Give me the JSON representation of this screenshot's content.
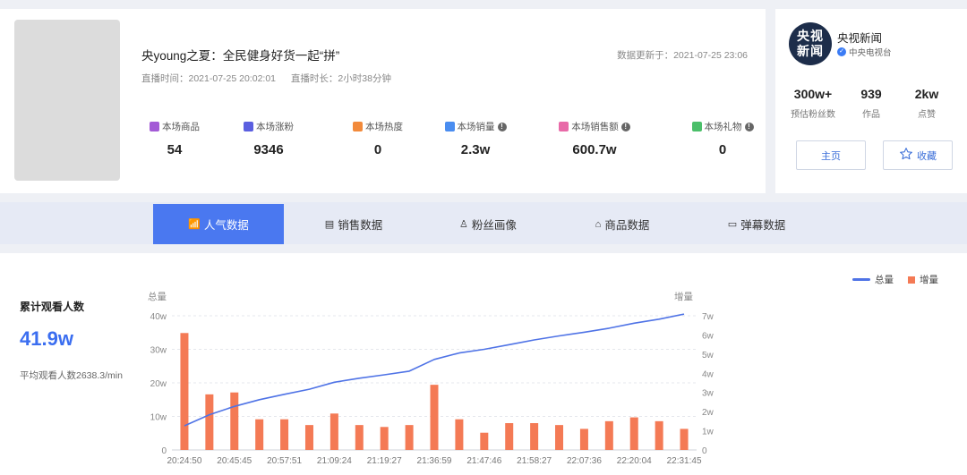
{
  "live": {
    "title": "央young之夏：全民健身好货一起“拼”",
    "start_time": "直播时间：2021-07-25 20:02:01",
    "duration": "直播时长：2小时38分钟",
    "updated": "数据更新于：2021-07-25 23:06",
    "stats": [
      {
        "label": "本场商品",
        "value": "54",
        "icon": "bag-icon",
        "color": "#a35ad6",
        "info": false
      },
      {
        "label": "本场涨粉",
        "value": "9346",
        "icon": "user-icon",
        "color": "#5b5fe0",
        "info": false
      },
      {
        "label": "本场热度",
        "value": "0",
        "icon": "fire-icon",
        "color": "#f28a3b",
        "info": false
      },
      {
        "label": "本场销量",
        "value": "2.3w",
        "icon": "sales-icon",
        "color": "#4a8df0",
        "info": true
      },
      {
        "label": "本场销售额",
        "value": "600.7w",
        "icon": "money-bag-icon",
        "color": "#e86aa8",
        "info": true
      },
      {
        "label": "本场礼物",
        "value": "0",
        "icon": "gift-icon",
        "color": "#4bbf6a",
        "info": true
      }
    ]
  },
  "anchor": {
    "avatar_text": "央视新闻",
    "name": "央视新闻",
    "org": "中央电视台",
    "stats": [
      {
        "value": "300w+",
        "label": "预估粉丝数"
      },
      {
        "value": "939",
        "label": "作品"
      },
      {
        "value": "2kw",
        "label": "点赞"
      }
    ],
    "home_button": "主页",
    "fav_button": "收藏"
  },
  "tabs": [
    {
      "label": "人气数据",
      "active": true,
      "icon": "chart-icon"
    },
    {
      "label": "销售数据",
      "active": false,
      "icon": "sales-doc-icon"
    },
    {
      "label": "粉丝画像",
      "active": false,
      "icon": "fans-icon"
    },
    {
      "label": "商品数据",
      "active": false,
      "icon": "shop-icon"
    },
    {
      "label": "弹幕数据",
      "active": false,
      "icon": "danmaku-icon"
    }
  ],
  "summary": {
    "label": "累计观看人数",
    "value": "41.9w",
    "avg": "平均观看人数2638.3/min"
  },
  "chart_data": {
    "type": "bar",
    "left_axis_title": "总量",
    "right_axis_title": "增量",
    "left_ticks": [
      "0",
      "10w",
      "20w",
      "30w",
      "40w"
    ],
    "right_ticks": [
      "0",
      "1w",
      "2w",
      "3w",
      "4w",
      "5w",
      "6w",
      "7w"
    ],
    "x_tick_labels": [
      "20:24:50",
      "20:45:45",
      "20:57:51",
      "21:09:24",
      "21:19:27",
      "21:36:59",
      "21:47:46",
      "21:58:27",
      "22:07:36",
      "22:20:04",
      "22:31:45"
    ],
    "legend": [
      {
        "name": "总量",
        "kind": "line"
      },
      {
        "name": "增量",
        "kind": "bar"
      }
    ],
    "colors": {
      "line": "#4f73e6",
      "bar": "#f47a55"
    },
    "left_ylim": [
      0,
      40
    ],
    "right_ylim": [
      0,
      7
    ],
    "series": [
      {
        "name": "增量",
        "kind": "bar",
        "axis": "right",
        "unit": "w",
        "values": [
          6.1,
          2.9,
          3.0,
          1.6,
          1.6,
          1.3,
          1.9,
          1.3,
          1.2,
          1.3,
          3.4,
          1.6,
          0.9,
          1.4,
          1.4,
          1.3,
          1.1,
          1.5,
          1.7,
          1.5,
          1.1
        ]
      },
      {
        "name": "总量",
        "kind": "line",
        "axis": "left",
        "unit": "w",
        "values": [
          7.2,
          10.5,
          13.0,
          15.0,
          16.6,
          18.1,
          20.2,
          21.4,
          22.4,
          23.5,
          27.0,
          28.9,
          30.0,
          31.4,
          32.8,
          34.0,
          35.1,
          36.3,
          37.8,
          39.0,
          40.5
        ]
      }
    ]
  }
}
